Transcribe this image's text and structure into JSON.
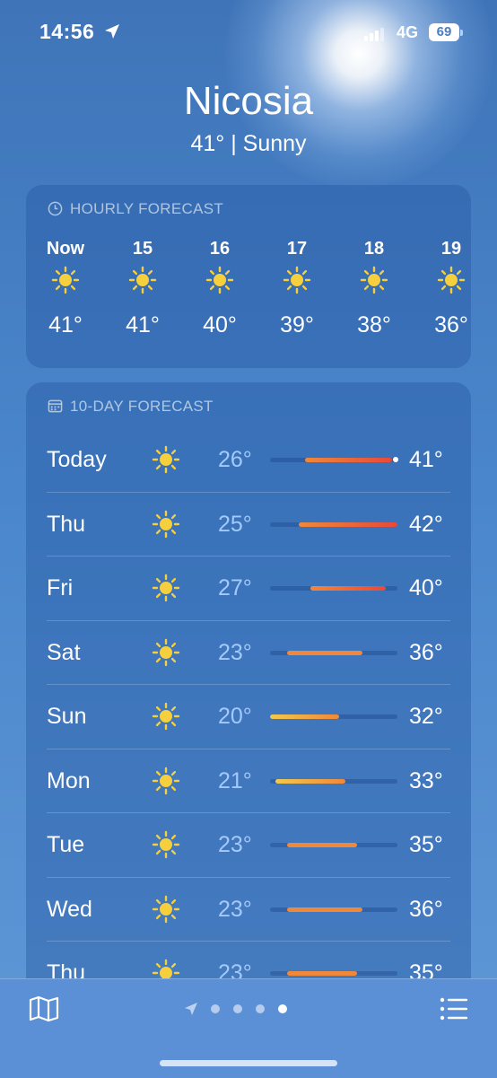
{
  "status_bar": {
    "time": "14:56",
    "network": "4G",
    "battery": "69"
  },
  "location": {
    "city": "Nicosia",
    "summary": "41°  |  Sunny"
  },
  "hourly": {
    "header": "HOURLY FORECAST",
    "items": [
      {
        "label": "Now",
        "temp": "41°",
        "icon": "sun-icon"
      },
      {
        "label": "15",
        "temp": "41°",
        "icon": "sun-icon"
      },
      {
        "label": "16",
        "temp": "40°",
        "icon": "sun-icon"
      },
      {
        "label": "17",
        "temp": "39°",
        "icon": "sun-icon"
      },
      {
        "label": "18",
        "temp": "38°",
        "icon": "sun-icon"
      },
      {
        "label": "19",
        "temp": "36°",
        "icon": "sun-icon"
      }
    ]
  },
  "daily": {
    "header": "10-DAY FORECAST",
    "range_min": 20,
    "range_max": 42,
    "current_temp": 41,
    "days": [
      {
        "day": "Today",
        "low": "26°",
        "high": "41°",
        "low_val": 26,
        "high_val": 41,
        "icon": "sun-icon"
      },
      {
        "day": "Thu",
        "low": "25°",
        "high": "42°",
        "low_val": 25,
        "high_val": 42,
        "icon": "sun-icon"
      },
      {
        "day": "Fri",
        "low": "27°",
        "high": "40°",
        "low_val": 27,
        "high_val": 40,
        "icon": "sun-icon"
      },
      {
        "day": "Sat",
        "low": "23°",
        "high": "36°",
        "low_val": 23,
        "high_val": 36,
        "icon": "sun-icon"
      },
      {
        "day": "Sun",
        "low": "20°",
        "high": "32°",
        "low_val": 20,
        "high_val": 32,
        "icon": "sun-icon"
      },
      {
        "day": "Mon",
        "low": "21°",
        "high": "33°",
        "low_val": 21,
        "high_val": 33,
        "icon": "sun-icon"
      },
      {
        "day": "Tue",
        "low": "23°",
        "high": "35°",
        "low_val": 23,
        "high_val": 35,
        "icon": "sun-icon"
      },
      {
        "day": "Wed",
        "low": "23°",
        "high": "36°",
        "low_val": 23,
        "high_val": 36,
        "icon": "sun-icon"
      },
      {
        "day": "Thu",
        "low": "23°",
        "high": "35°",
        "low_val": 23,
        "high_val": 35,
        "icon": "sun-icon"
      }
    ]
  },
  "tab_bar": {
    "page_count": 5,
    "active_page": 4
  },
  "colors": {
    "sun_yellow": "#f6cf3d",
    "bar_cool": "#f2c94c",
    "bar_warm": "#f0883a",
    "bar_hot": "#e8493a"
  }
}
